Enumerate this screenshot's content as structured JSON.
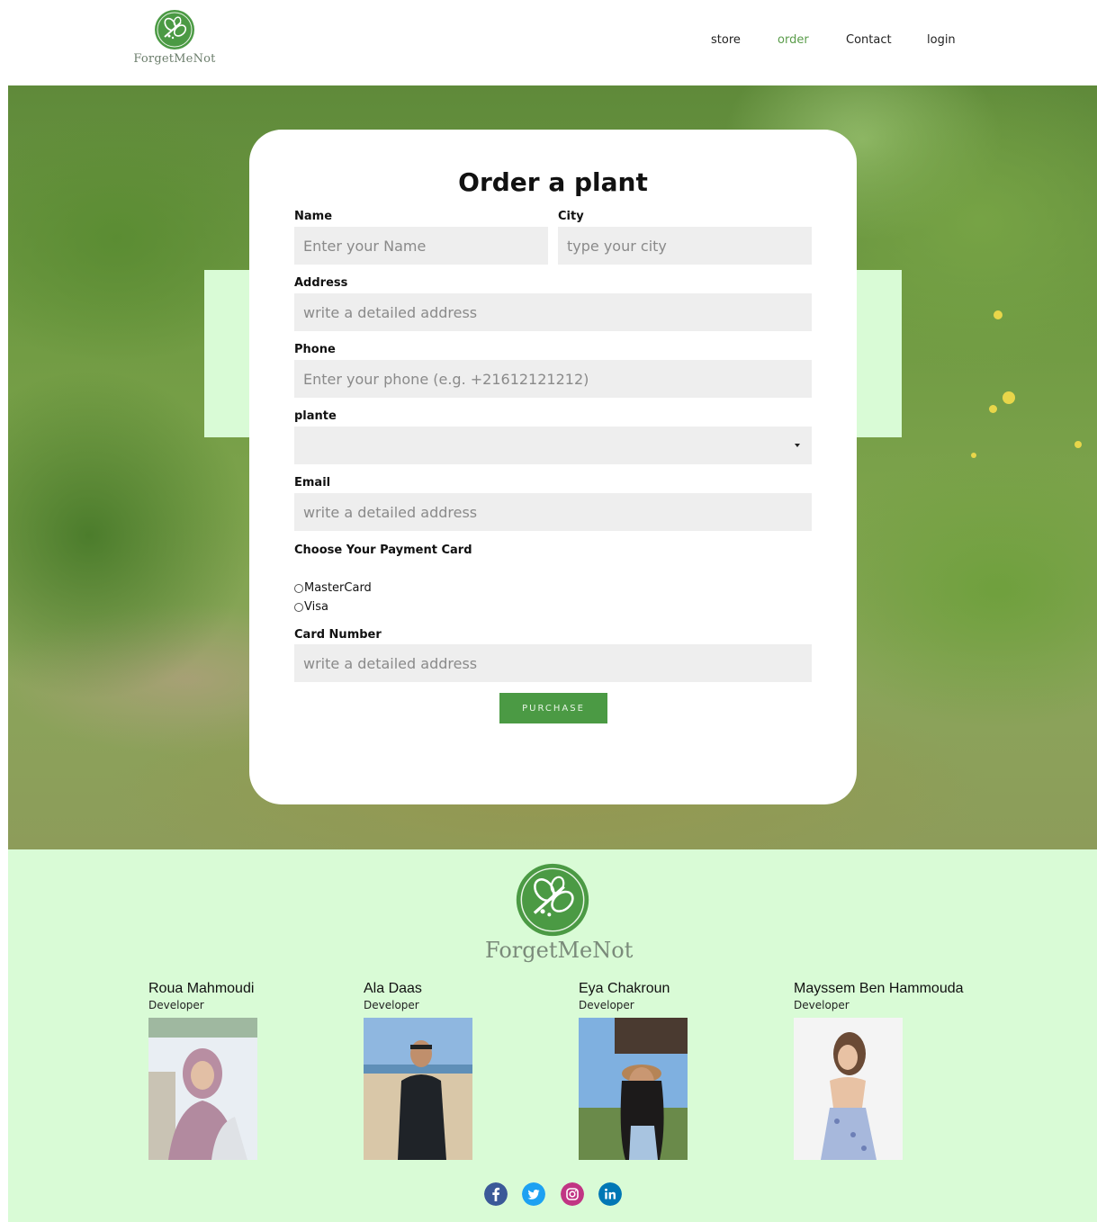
{
  "brand": {
    "name": "ForgetMeNot",
    "color": "#4b9a44",
    "mint": "#d9fbd6"
  },
  "nav": {
    "items": [
      {
        "label": "store",
        "active": false
      },
      {
        "label": "order",
        "active": true
      },
      {
        "label": "Contact",
        "active": false
      },
      {
        "label": "login",
        "active": false
      }
    ]
  },
  "form": {
    "title": "Order a plant",
    "name": {
      "label": "Name",
      "placeholder": "Enter your Name",
      "value": ""
    },
    "city": {
      "label": "City",
      "placeholder": "type your city",
      "value": ""
    },
    "address": {
      "label": "Address",
      "placeholder": "write a detailed address",
      "value": ""
    },
    "phone": {
      "label": "Phone",
      "placeholder": "Enter your phone (e.g. +21612121212)",
      "value": ""
    },
    "plante": {
      "label": "plante",
      "selected": ""
    },
    "email": {
      "label": "Email",
      "placeholder": "write a detailed address",
      "value": ""
    },
    "payment": {
      "label": "Choose Your Payment Card",
      "options": [
        "MasterCard",
        "Visa"
      ],
      "selected": null
    },
    "card_number": {
      "label": "Card Number",
      "placeholder": "write a detailed address",
      "value": ""
    },
    "submit_label": "PURCHASE"
  },
  "footer": {
    "brand": "ForgetMeNot",
    "team": [
      {
        "name": "Roua Mahmoudi",
        "role": "Developer"
      },
      {
        "name": "Ala Daas",
        "role": "Developer"
      },
      {
        "name": "Eya Chakroun",
        "role": "Developer"
      },
      {
        "name": "Mayssem Ben Hammouda",
        "role": "Developer"
      }
    ],
    "socials": [
      {
        "icon": "facebook-icon",
        "color": "#3b5998"
      },
      {
        "icon": "twitter-icon",
        "color": "#1da1f2"
      },
      {
        "icon": "instagram-icon",
        "color": "#c13584"
      },
      {
        "icon": "linkedin-icon",
        "color": "#0077b5"
      }
    ]
  }
}
